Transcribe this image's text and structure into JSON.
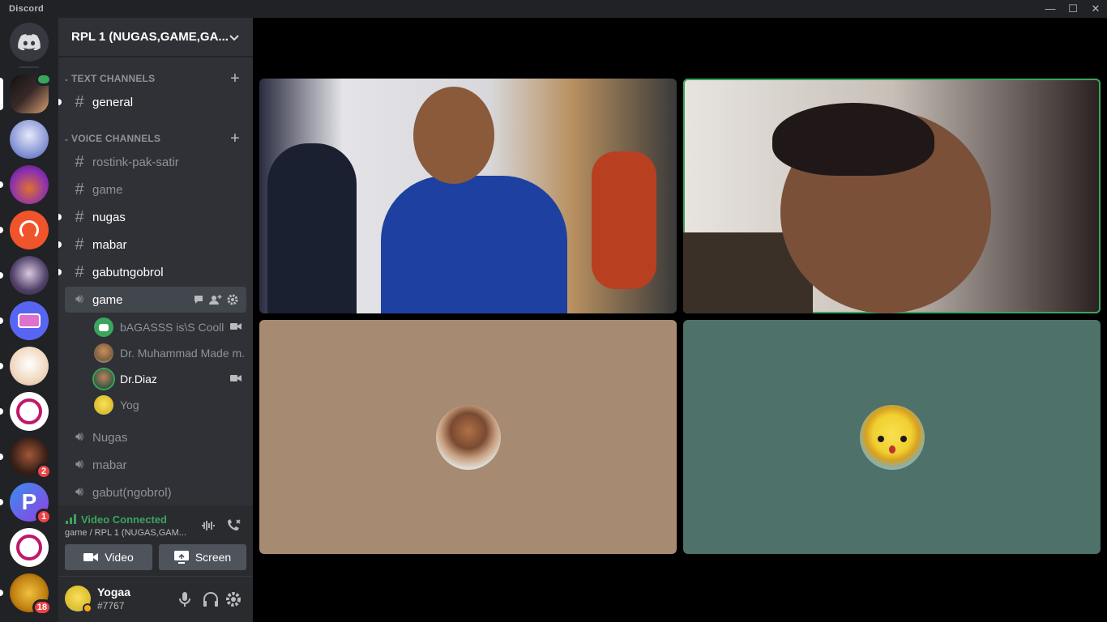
{
  "app": {
    "title": "Discord"
  },
  "server": {
    "name": "RPL 1 (NUGAS,GAME,GA..."
  },
  "categories": {
    "text": "TEXT CHANNELS",
    "voice": "VOICE CHANNELS"
  },
  "text_channels": [
    {
      "label": "general"
    }
  ],
  "channels": [
    {
      "label": "rostink-pak-satir"
    },
    {
      "label": "game"
    },
    {
      "label": "nugas"
    },
    {
      "label": "mabar"
    },
    {
      "label": "gabutngobrol"
    }
  ],
  "active_voice": {
    "label": "game",
    "users": [
      {
        "name": "bAGASSS is\\S Cooll"
      },
      {
        "name": "Dr. Muhammad Made m..."
      },
      {
        "name": "Dr.Diaz"
      },
      {
        "name": "Yog"
      }
    ]
  },
  "voice_channels": [
    {
      "label": "Nugas"
    },
    {
      "label": "mabar"
    },
    {
      "label": "gabut(ngobrol)"
    }
  ],
  "voice_panel": {
    "status": "Video Connected",
    "location": "game / RPL 1 (NUGAS,GAM...",
    "video_label": "Video",
    "screen_label": "Screen"
  },
  "user": {
    "name": "Yogaa",
    "tag": "#7767"
  },
  "guild_badges": {
    "g9": "2",
    "g10": "1",
    "g12": "18"
  },
  "colors": {
    "accent": "#5865f2",
    "connected": "#3ba55d",
    "speaking": "#3ba55d",
    "tile_tan": "#a68b72",
    "tile_teal": "#4e716a"
  }
}
